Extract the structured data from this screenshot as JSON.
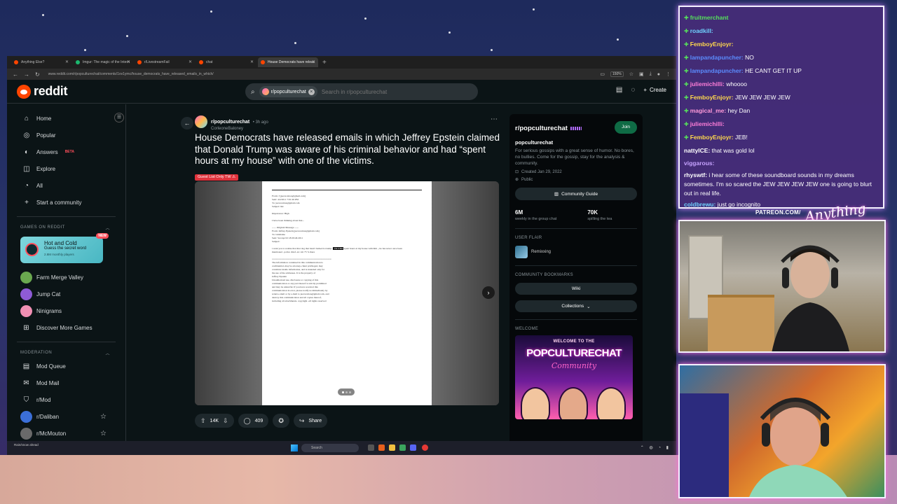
{
  "browser": {
    "tabs": [
      {
        "label": "Anything Else?"
      },
      {
        "label": "Imgur: The magic of the Intern"
      },
      {
        "label": "r/LivestreamFail"
      },
      {
        "label": "chat"
      },
      {
        "label": "House Democrats have releas"
      }
    ],
    "url": "www.reddit.com/r/popculturechat/comments/1ov1ymc/house_democrats_have_released_emails_in_which/",
    "zoom": "150%"
  },
  "reddit": {
    "logo_text": "reddit",
    "search": {
      "chip": "r/popculturechat",
      "placeholder": "Search in r/popculturechat"
    },
    "create_label": "Create",
    "nav": [
      {
        "label": "Home"
      },
      {
        "label": "Popular"
      },
      {
        "label": "Answers",
        "badge": "BETA"
      },
      {
        "label": "Explore"
      },
      {
        "label": "All"
      },
      {
        "label": "Start a community"
      }
    ],
    "games_heading": "GAMES ON REDDIT",
    "featured_game": {
      "title": "Hot and Cold",
      "subtitle": "Guess the secret word",
      "stat": "2.8M monthly players",
      "badge": "NEW"
    },
    "games": [
      {
        "label": "Farm Merge Valley"
      },
      {
        "label": "Jump Cat"
      },
      {
        "label": "Ninigrams"
      },
      {
        "label": "Discover More Games"
      }
    ],
    "moderation_heading": "MODERATION",
    "moderation": [
      {
        "label": "Mod Queue"
      },
      {
        "label": "Mod Mail"
      },
      {
        "label": "r/Mod"
      },
      {
        "label": "r/Daliban"
      },
      {
        "label": "r/McMouton"
      }
    ]
  },
  "post": {
    "subreddit": "r/popculturechat",
    "time": "• 3h ago",
    "author": "CorleoneBaloney",
    "title": "House Democrats have released emails in which Jeffrey Epstein claimed that Donald Trump was aware of his criminal behavior and had “spent hours at my house” with one of the victims.",
    "flair": "Guest List Only TW ⚠",
    "votes": "14K",
    "comments": "409",
    "share_label": "Share",
    "document_lines": [
      "From:      J [jeevacation@gmail.com]",
      "Sent:      4/2/2011 7:01:26 PM",
      "To:        jeevacation@gmail.com",
      "Subject:   Re:",
      "",
      "Importance:   High",
      "",
      "I have been thinking about that...",
      "",
      "----- Original Message -----",
      "From: Jeffrey Epstein [jeevacation@gmail.com]",
      "To: Ghislaine",
      "Sent: Sat Apr 02 18:29:46 2011",
      "Subject:",
      "",
      "i want you to realize that that dog that hasn't barked is trump.. VICTIM spent hours at my house with him ,, he has never once been",
      "mentioned . police chief. etc.  im 75 % there",
      "",
      "===========================================",
      "The information contained in this communication is",
      "confidential, may be attorney-client privileged, may",
      "constitute inside information, and is intended only for",
      "the use of the addressee. It is the property of",
      "Jeffrey Epstein",
      "Unauthorized use, disclosure or copying of this",
      "communication or any part thereof is strictly prohibited",
      "and may be unlawful. If you have received this",
      "communication in error, please notify us immediately by",
      "return e-mail or by e-mail to jeevacation@gmail.com, and",
      "destroy this communication and all copies thereof,",
      "including all attachments. copyright -all rights reserved"
    ]
  },
  "community": {
    "name": "r/popculturechat",
    "join_label": "Join",
    "title": "popculturechat",
    "description": "For serious gossips with a great sense of humor. No bores, no bullies. Come for the gossip, stay for the analysis & community.",
    "created": "Created Jan 29, 2022",
    "visibility": "Public",
    "guide_label": "Community Guide",
    "stats": [
      {
        "value": "6M",
        "label": "weekly in the group chat"
      },
      {
        "value": "70K",
        "label": "spilling the tea"
      }
    ],
    "user_flair_heading": "USER FLAIR",
    "user_flair": "Remixxing",
    "bookmarks_heading": "COMMUNITY BOOKMARKS",
    "bookmarks": [
      {
        "label": "Wiki"
      },
      {
        "label": "Collections"
      }
    ],
    "welcome_heading": "WELCOME",
    "banner": {
      "line1": "WELCOME TO THE",
      "name": "POPCULTURECHAT",
      "tagline": "Community"
    }
  },
  "taskbar": {
    "weather": "Rain/snow ahead",
    "search_placeholder": "Search"
  },
  "stream": {
    "patreon": "PATREON.COM/",
    "brand": "Anything Else?",
    "chat": [
      {
        "user": "fruitmerchant",
        "text": "",
        "color": "#56e05c",
        "badge": true
      },
      {
        "user": "roadkill:",
        "text": "",
        "color": "#6fd3ff",
        "badge": true
      },
      {
        "user": "FemboyEnjoyr:",
        "text": "",
        "color": "#ffd84d",
        "badge": true
      },
      {
        "user": "lampandapuncher:",
        "text": "NO",
        "color": "#5b8cff",
        "badge": true
      },
      {
        "user": "lampandapuncher:",
        "text": "HE CANT GET IT UP",
        "color": "#5b8cff",
        "badge": true
      },
      {
        "user": "juliemichilli:",
        "text": "whoooo",
        "color": "#ff7dd8",
        "badge": true
      },
      {
        "user": "FemboyEnjoyr:",
        "text": "JEW JEW JEW JEW",
        "color": "#ffd84d",
        "badge": true
      },
      {
        "user": "magical_me:",
        "text": "hey Dan",
        "color": "#ff9ad9",
        "badge": true
      },
      {
        "user": "juliemichilli:",
        "text": "",
        "color": "#ff7dd8",
        "badge": true
      },
      {
        "user": "FemboyEnjoyr:",
        "text": "JEB!",
        "color": "#ffd84d",
        "badge": true
      },
      {
        "user": "nattyICE:",
        "text": "that was gold lol",
        "color": "#ffffff",
        "badge": false
      },
      {
        "user": "viggarous:",
        "text": "",
        "color": "#c6a2ff",
        "badge": false
      },
      {
        "user": "rhyswtf:",
        "text": "i hear some of these soundboard sounds in my dreams sometimes. I'm so scared the JEW JEW JEW JEW one is going to blurt out in real life.",
        "color": "#ffffff",
        "badge": false
      },
      {
        "user": "coldbrewu:",
        "text": "just go incognito",
        "color": "#6fd3ff",
        "badge": false
      }
    ]
  }
}
